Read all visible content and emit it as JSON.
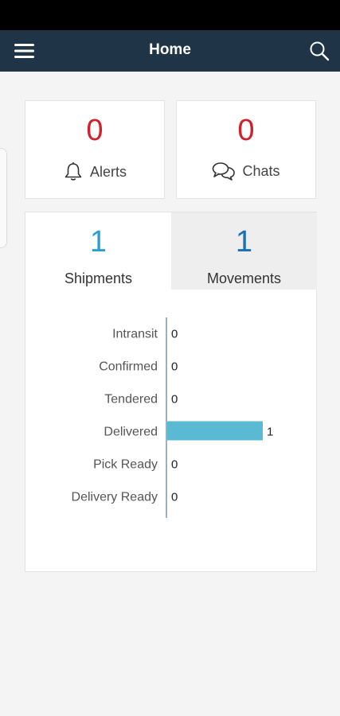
{
  "header": {
    "title": "Home"
  },
  "summary": {
    "alerts": {
      "count": "0",
      "label": "Alerts"
    },
    "chats": {
      "count": "0",
      "label": "Chats"
    }
  },
  "tabs": [
    {
      "count": "1",
      "label": "Shipments"
    },
    {
      "count": "1",
      "label": "Movements"
    }
  ],
  "chart_data": {
    "type": "bar",
    "orientation": "horizontal",
    "categories": [
      "Intransit",
      "Confirmed",
      "Tendered",
      "Delivered",
      "Pick Ready",
      "Delivery Ready"
    ],
    "values": [
      0,
      0,
      0,
      1,
      0,
      0
    ],
    "value_labels": [
      "0",
      "0",
      "0",
      "1",
      "0",
      "0"
    ],
    "xlim": [
      0,
      1.5
    ],
    "grid": false,
    "bar_color": "#5ab9d3",
    "axis_color": "#9ab0c4"
  },
  "colors": {
    "app_bar": "#1f3447",
    "alert_count": "#d0202a",
    "shipments_count": "#2b9fd1",
    "movements_count": "#1a6fb5"
  },
  "icons": {
    "menu": "hamburger-icon",
    "search": "search-icon",
    "alerts": "bell-icon",
    "chats": "chat-bubbles-icon"
  }
}
